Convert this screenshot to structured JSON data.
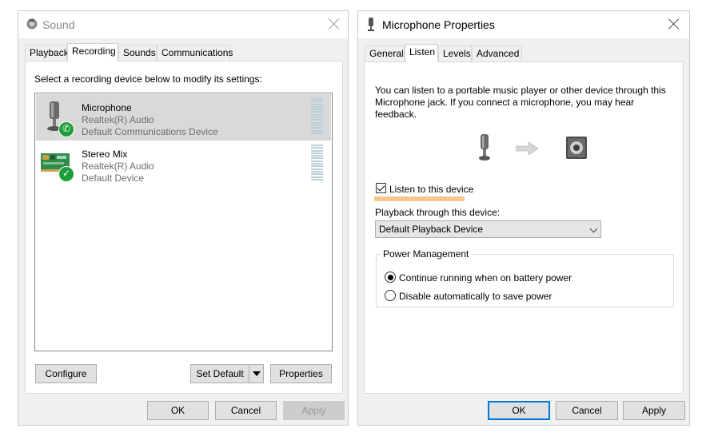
{
  "sound_window": {
    "title": "Sound",
    "tabs": [
      {
        "label": "Playback"
      },
      {
        "label": "Recording"
      },
      {
        "label": "Sounds"
      },
      {
        "label": "Communications"
      }
    ],
    "instruction": "Select a recording device below to modify its settings:",
    "devices": [
      {
        "name": "Microphone",
        "driver": "Realtek(R) Audio",
        "status": "Default Communications Device",
        "badge_icon": "phone-icon"
      },
      {
        "name": "Stereo Mix",
        "driver": "Realtek(R) Audio",
        "status": "Default Device",
        "badge_icon": "checkmark-icon"
      }
    ],
    "buttons": {
      "configure": "Configure",
      "set_default": "Set Default",
      "properties": "Properties",
      "ok": "OK",
      "cancel": "Cancel",
      "apply": "Apply"
    }
  },
  "mic_window": {
    "title": "Microphone Properties",
    "tabs": [
      {
        "label": "General"
      },
      {
        "label": "Listen"
      },
      {
        "label": "Levels"
      },
      {
        "label": "Advanced"
      }
    ],
    "description": "You can listen to a portable music player or other device through this Microphone jack.  If you connect a microphone, you may hear feedback.",
    "listen_checkbox_label": "Listen to this device",
    "playback_label": "Playback through this device:",
    "playback_selected": "Default Playback Device",
    "power_group_title": "Power Management",
    "power_options": [
      {
        "label": "Continue running when on battery power",
        "selected": true
      },
      {
        "label": "Disable automatically to save power",
        "selected": false
      }
    ],
    "buttons": {
      "ok": "OK",
      "cancel": "Cancel",
      "apply": "Apply"
    }
  },
  "colors": {
    "highlight_underline": "#f5c78e",
    "badge_green": "#1e9e3a",
    "focus_blue": "#0078d7"
  }
}
